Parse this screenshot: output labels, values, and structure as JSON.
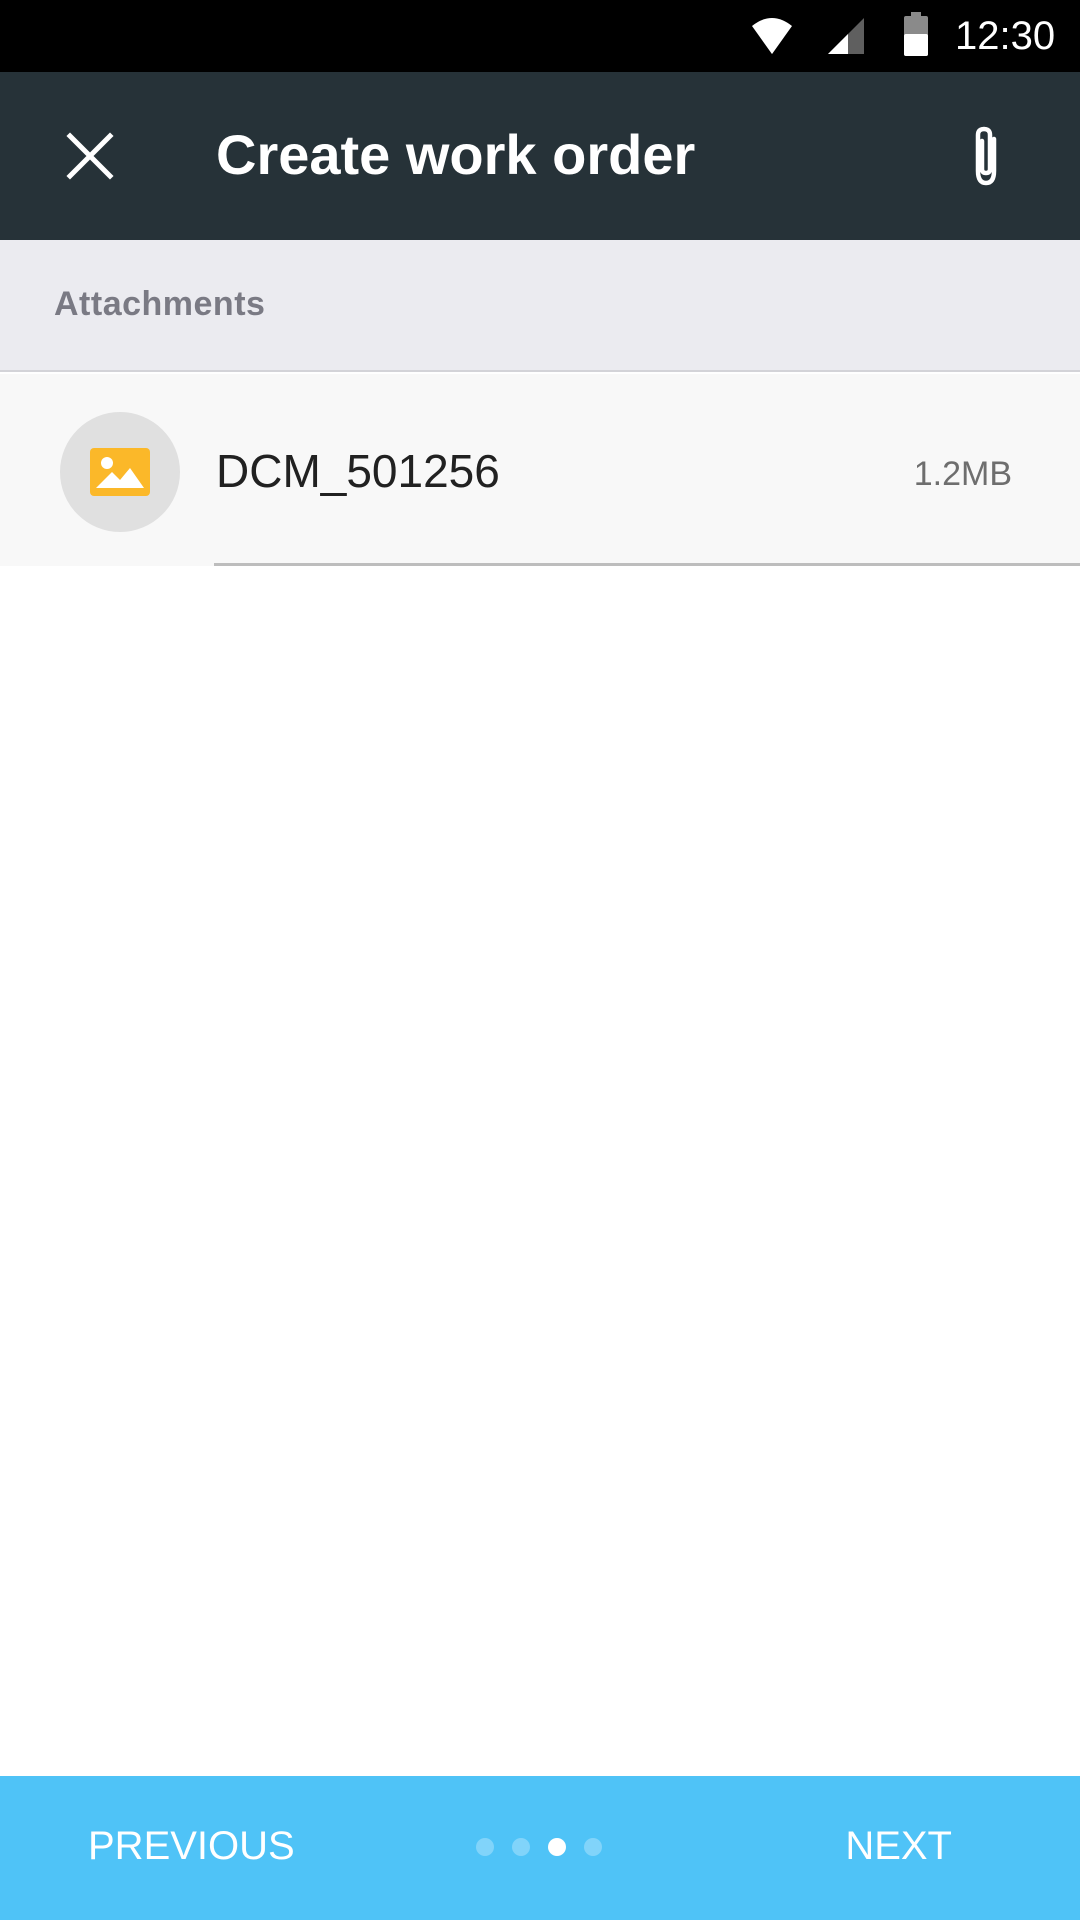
{
  "status_bar": {
    "time": "12:30",
    "icons": [
      "wifi-icon",
      "cell-signal-icon",
      "battery-icon"
    ]
  },
  "app_bar": {
    "title": "Create work order",
    "close_icon": "close-icon",
    "attach_icon": "paperclip-icon",
    "background_color": "#263238"
  },
  "section": {
    "label": "Attachments"
  },
  "attachments": [
    {
      "name": "DCM_501256",
      "size": "1.2MB",
      "icon": "image-icon",
      "icon_color": "#fbb829"
    }
  ],
  "bottom_nav": {
    "previous_label": "PREVIOUS",
    "next_label": "NEXT",
    "page_count": 4,
    "current_page": 3,
    "background_color": "#4fc3f7"
  }
}
